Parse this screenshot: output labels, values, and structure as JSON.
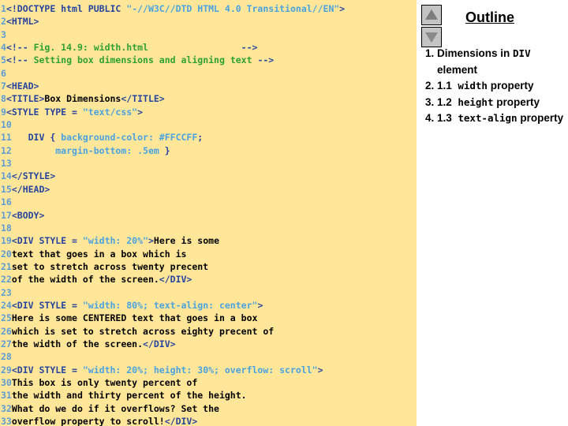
{
  "code_panel": {
    "background_color": "#FFE699",
    "colors": {
      "line_number": "#5C9BD6",
      "tag": "#27449E",
      "string": "#4AA3E0",
      "comment": "#2FA12F",
      "text": "#000000"
    },
    "lines": [
      {
        "n": "1",
        "parts": [
          {
            "t": "tag",
            "s": "<!DOCTYPE html PUBLIC "
          },
          {
            "t": "str",
            "s": "\"-//W3C//DTD HTML 4.0 Transitional//EN\""
          },
          {
            "t": "tag",
            "s": ">"
          }
        ]
      },
      {
        "n": "2",
        "parts": [
          {
            "t": "tag",
            "s": "<HTML>"
          }
        ]
      },
      {
        "n": "3",
        "parts": []
      },
      {
        "n": "4",
        "parts": [
          {
            "t": "tag",
            "s": "<!--"
          },
          {
            "t": "cmt",
            "s": " Fig. 14.9: width.html                 "
          },
          {
            "t": "tag",
            "s": "-->"
          }
        ]
      },
      {
        "n": "5",
        "parts": [
          {
            "t": "tag",
            "s": "<!--"
          },
          {
            "t": "cmt",
            "s": " Setting box dimensions and aligning text "
          },
          {
            "t": "tag",
            "s": "-->"
          }
        ]
      },
      {
        "n": "6",
        "parts": []
      },
      {
        "n": "7",
        "parts": [
          {
            "t": "tag",
            "s": "<HEAD>"
          }
        ]
      },
      {
        "n": "8",
        "parts": [
          {
            "t": "tag",
            "s": "<TITLE>"
          },
          {
            "t": "txt",
            "s": "Box Dimensions"
          },
          {
            "t": "tag",
            "s": "</TITLE>"
          }
        ]
      },
      {
        "n": "9",
        "parts": [
          {
            "t": "tag",
            "s": "<STYLE TYPE = "
          },
          {
            "t": "str",
            "s": "\"text/css\""
          },
          {
            "t": "tag",
            "s": ">"
          }
        ]
      },
      {
        "n": "10",
        "parts": []
      },
      {
        "n": "11",
        "parts": [
          {
            "t": "tag",
            "s": "   DIV { "
          },
          {
            "t": "attr",
            "s": "background-color: #FFCCFF"
          },
          {
            "t": "tag",
            "s": ";"
          }
        ]
      },
      {
        "n": "12",
        "parts": [
          {
            "t": "tag",
            "s": "        "
          },
          {
            "t": "attr",
            "s": "margin-bottom: .5em"
          },
          {
            "t": "tag",
            "s": " }"
          }
        ]
      },
      {
        "n": "13",
        "parts": []
      },
      {
        "n": "14",
        "parts": [
          {
            "t": "tag",
            "s": "</STYLE>"
          }
        ]
      },
      {
        "n": "15",
        "parts": [
          {
            "t": "tag",
            "s": "</HEAD>"
          }
        ]
      },
      {
        "n": "16",
        "parts": []
      },
      {
        "n": "17",
        "parts": [
          {
            "t": "tag",
            "s": "<BODY>"
          }
        ]
      },
      {
        "n": "18",
        "parts": []
      },
      {
        "n": "19",
        "parts": [
          {
            "t": "tag",
            "s": "<DIV STYLE = "
          },
          {
            "t": "str",
            "s": "\"width: 20%\""
          },
          {
            "t": "tag",
            "s": ">"
          },
          {
            "t": "txt",
            "s": "Here is some"
          }
        ]
      },
      {
        "n": "20",
        "parts": [
          {
            "t": "txt",
            "s": "text that goes in a box which is"
          }
        ]
      },
      {
        "n": "21",
        "parts": [
          {
            "t": "txt",
            "s": "set to stretch across twenty precent"
          }
        ]
      },
      {
        "n": "22",
        "parts": [
          {
            "t": "txt",
            "s": "of the width of the screen."
          },
          {
            "t": "tag",
            "s": "</DIV>"
          }
        ]
      },
      {
        "n": "23",
        "parts": []
      },
      {
        "n": "24",
        "parts": [
          {
            "t": "tag",
            "s": "<DIV STYLE = "
          },
          {
            "t": "str",
            "s": "\"width: 80%; text-align: center\""
          },
          {
            "t": "tag",
            "s": ">"
          }
        ]
      },
      {
        "n": "25",
        "parts": [
          {
            "t": "txt",
            "s": "Here is some CENTERED text that goes in a box"
          }
        ]
      },
      {
        "n": "26",
        "parts": [
          {
            "t": "txt",
            "s": "which is set to stretch across eighty precent of"
          }
        ]
      },
      {
        "n": "27",
        "parts": [
          {
            "t": "txt",
            "s": "the width of the screen."
          },
          {
            "t": "tag",
            "s": "</DIV>"
          }
        ]
      },
      {
        "n": "28",
        "parts": []
      },
      {
        "n": "29",
        "parts": [
          {
            "t": "tag",
            "s": "<DIV STYLE = "
          },
          {
            "t": "str",
            "s": "\"width: 20%; height: 30%; overflow: scroll\""
          },
          {
            "t": "tag",
            "s": ">"
          }
        ]
      },
      {
        "n": "30",
        "parts": [
          {
            "t": "txt",
            "s": "This box is only twenty percent of"
          }
        ]
      },
      {
        "n": "31",
        "parts": [
          {
            "t": "txt",
            "s": "the width and thirty percent of the height."
          }
        ]
      },
      {
        "n": "32",
        "parts": [
          {
            "t": "txt",
            "s": "What do we do if it overflows? Set the"
          }
        ]
      },
      {
        "n": "33",
        "parts": [
          {
            "t": "txt",
            "s": "overflow property to scroll!"
          },
          {
            "t": "tag",
            "s": "</DIV>"
          }
        ]
      }
    ]
  },
  "outline_panel": {
    "title": "Outline",
    "scroll_up_icon": "triangle-up-icon",
    "scroll_down_icon": "triangle-down-icon",
    "items": [
      {
        "number": "1.",
        "segments": [
          {
            "style": "sans",
            "s": "Dimensions in "
          },
          {
            "style": "mono",
            "s": "DIV"
          },
          {
            "style": "sans",
            "s": " element"
          }
        ]
      },
      {
        "number": "2.",
        "segments": [
          {
            "style": "sans",
            "s": "1.1"
          },
          {
            "style": "gap",
            "s": "   "
          },
          {
            "style": "mono",
            "s": "width"
          },
          {
            "style": "sans",
            "s": " property"
          }
        ]
      },
      {
        "number": "3.",
        "segments": [
          {
            "style": "sans",
            "s": "1.2"
          },
          {
            "style": "gap",
            "s": "   "
          },
          {
            "style": "mono",
            "s": "height"
          },
          {
            "style": "sans",
            "s": " property"
          }
        ]
      },
      {
        "number": "4.",
        "segments": [
          {
            "style": "sans",
            "s": "1.3"
          },
          {
            "style": "gap",
            "s": "   "
          },
          {
            "style": "mono",
            "s": "text-align"
          },
          {
            "style": "sans",
            "s": " property"
          }
        ]
      }
    ]
  }
}
